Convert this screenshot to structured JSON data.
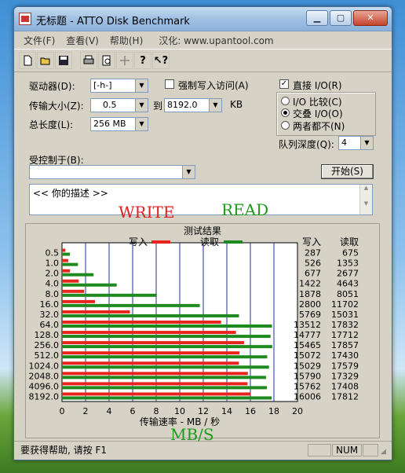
{
  "window": {
    "title": "无标题 - ATTO Disk Benchmark"
  },
  "menu": [
    "文件(F)",
    "查看(V)",
    "帮助(H)",
    "汉化: www.upantool.com"
  ],
  "toolbar_icons": [
    "new-icon",
    "open-icon",
    "save-icon",
    "print-icon",
    "print-preview-icon",
    "move-icon",
    "help-icon",
    "context-help-icon"
  ],
  "settings": {
    "drive_label": "驱动器(D):",
    "drive_value": "[-h-]",
    "force_write_label": "强制写入访问(A)",
    "transfer_label": "传输大小(Z):",
    "transfer_from": "0.5",
    "to_label": "到",
    "transfer_to": "8192.0",
    "kb_label": "KB",
    "length_label": "总长度(L):",
    "length_value": "256 MB",
    "direct_io_label": "直接 I/O(R)",
    "io_compare_label": "I/O 比较(C)",
    "overlapped_io_label": "交叠 I/O(O)",
    "neither_label": "两者都不(N)",
    "queue_depth_label": "队列深度(Q):",
    "queue_depth_value": "4",
    "controlled_by_label": "受控制于(B):",
    "start_button": "开始(S)",
    "description_text": "<<  你的描述  >>"
  },
  "overlay": {
    "write": "WRITE",
    "read": "READ",
    "units": "MB/S"
  },
  "chart_data": {
    "type": "bar",
    "title": "测试结果",
    "legend": [
      {
        "name": "写入",
        "color": "#e8251c"
      },
      {
        "name": "读取",
        "color": "#1f8a1f"
      }
    ],
    "categories": [
      "0.5",
      "1.0",
      "2.0",
      "4.0",
      "8.0",
      "16.0",
      "32.0",
      "64.0",
      "128.0",
      "256.0",
      "512.0",
      "1024.0",
      "2048.0",
      "4096.0",
      "8192.0"
    ],
    "series": [
      {
        "name": "写入",
        "values": [
          287,
          526,
          677,
          1422,
          1878,
          2800,
          5769,
          13512,
          14777,
          15465,
          15072,
          15029,
          15790,
          15762,
          16006
        ]
      },
      {
        "name": "读取",
        "values": [
          675,
          1353,
          2677,
          4643,
          8051,
          11702,
          15031,
          17832,
          17712,
          17857,
          17430,
          17579,
          17329,
          17408,
          17812
        ]
      }
    ],
    "xlabel": "传输速率 - MB / 秒",
    "xlim": [
      0,
      20
    ],
    "xticks": [
      "0",
      "2",
      "4",
      "6",
      "8",
      "10",
      "12",
      "14",
      "16",
      "18",
      "20"
    ],
    "table_headers": [
      "写入",
      "读取"
    ],
    "grid": true
  },
  "status": {
    "help": "要获得帮助, 请按 F1",
    "num": "NUM"
  }
}
